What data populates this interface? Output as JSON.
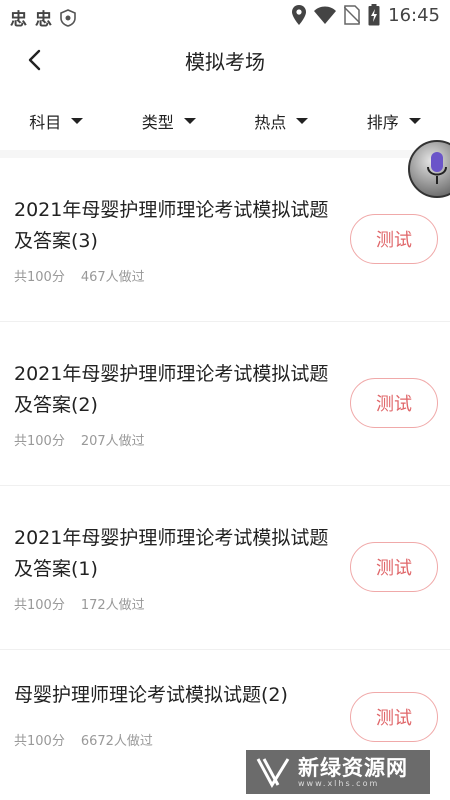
{
  "status_bar": {
    "app_icons": [
      "忠",
      "忠"
    ],
    "time": "16:45"
  },
  "header": {
    "title": "模拟考场"
  },
  "filters": [
    {
      "label": "科目"
    },
    {
      "label": "类型"
    },
    {
      "label": "热点"
    },
    {
      "label": "排序"
    }
  ],
  "exams": [
    {
      "title": "2021年母婴护理师理论考试模拟试题及答案(3)",
      "score": "共100分",
      "takers": "467人做过",
      "button": "测试"
    },
    {
      "title": "2021年母婴护理师理论考试模拟试题及答案(2)",
      "score": "共100分",
      "takers": "207人做过",
      "button": "测试"
    },
    {
      "title": "2021年母婴护理师理论考试模拟试题及答案(1)",
      "score": "共100分",
      "takers": "172人做过",
      "button": "测试"
    },
    {
      "title": "母婴护理师理论考试模拟试题(2)",
      "score": "共100分",
      "takers": "6672人做过",
      "button": "测试"
    }
  ],
  "watermark": {
    "text": "新绿资源网",
    "sub": "www.xlhs.com"
  },
  "colors": {
    "accent": "#e0676a",
    "button_border": "#f0a9a9",
    "meta_text": "#999999"
  }
}
